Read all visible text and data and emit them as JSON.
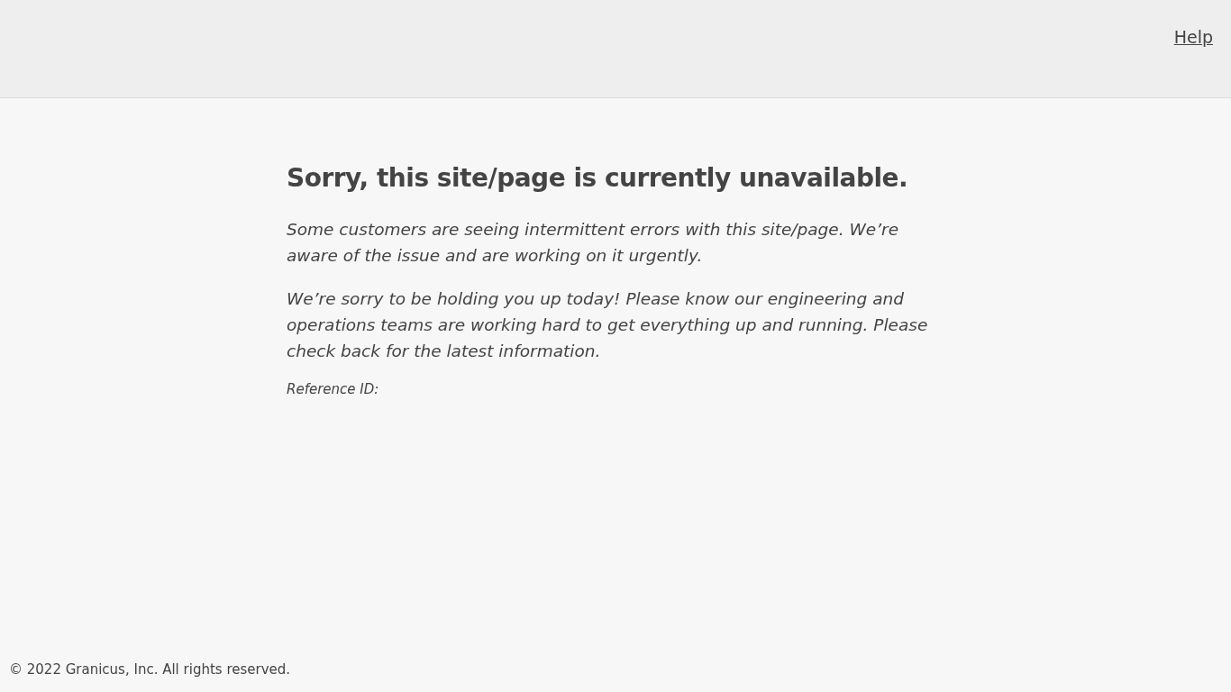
{
  "header": {
    "help_link": "Help"
  },
  "message": {
    "heading": "Sorry, this site/page is currently unavailable.",
    "paragraphs": [
      "Some customers are seeing intermittent errors with this site/page. We’re aware of the issue and are working on it urgently.",
      "We’re sorry to be holding you up today! Please know our engineering and operations teams are working hard to get everything up and running. Please check back for the latest information."
    ],
    "reference_label": "Reference ID:"
  },
  "footer": {
    "copyright": "© 2022 Granicus, Inc. All rights reserved."
  }
}
